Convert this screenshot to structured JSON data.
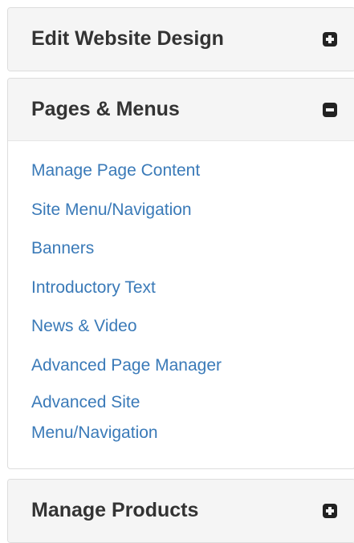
{
  "panels": [
    {
      "title": "Edit Website Design",
      "expanded": false,
      "toggle_icon": "plus-square-icon"
    },
    {
      "title": "Pages & Menus",
      "expanded": true,
      "toggle_icon": "minus-square-icon",
      "links": [
        "Manage Page Content",
        "Site Menu/Navigation",
        "Banners",
        "Introductory Text",
        "News & Video",
        "Advanced Page Manager",
        "Advanced Site Menu/Navigation"
      ]
    },
    {
      "title": "Manage Products",
      "expanded": false,
      "toggle_icon": "plus-square-icon"
    }
  ],
  "colors": {
    "heading_bg": "#f5f5f5",
    "heading_text": "#333333",
    "link": "#3a7ab8",
    "border": "#dddddd",
    "icon": "#222222"
  }
}
